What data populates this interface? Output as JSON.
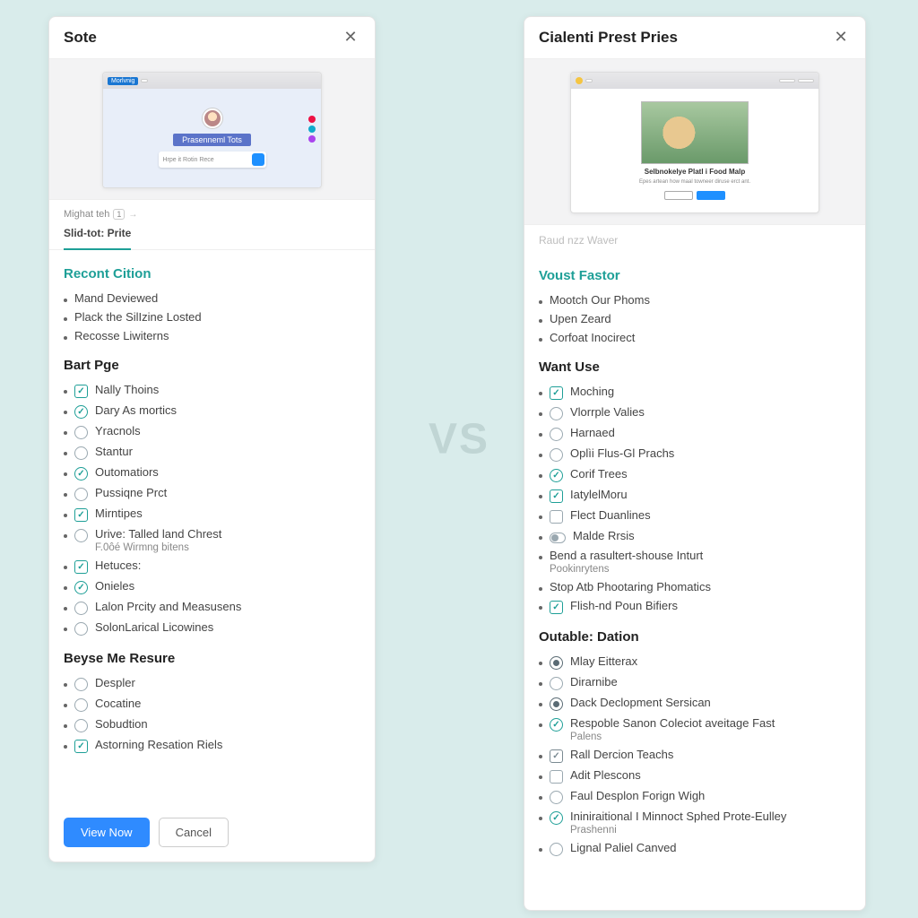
{
  "vs_label": "VS",
  "left": {
    "title": "Sote",
    "preview": {
      "chrome_tag": "Morlvnig",
      "caption": "Prasenneml Tots",
      "search_placeholder": "Hrpe it Rotin Rece"
    },
    "meta_line": "Mighat teh",
    "meta_badge": "1",
    "active_tab": "Slid-tot: Prite",
    "sections": [
      {
        "heading": "Recont Cition",
        "heading_style": "teal",
        "items": [
          {
            "label": "Mand Deviewed",
            "kind": "bullet"
          },
          {
            "label": "Plack the SilIzine Losted",
            "kind": "bullet"
          },
          {
            "label": "Recosse Liwiterns",
            "kind": "bullet"
          }
        ]
      },
      {
        "heading": "Bart Pge",
        "heading_style": "plain",
        "items": [
          {
            "label": "Nally Thoins",
            "kind": "square-filled"
          },
          {
            "label": "Dary As mortics",
            "kind": "circle-filled"
          },
          {
            "label": "Yracnols",
            "kind": "circle-empty"
          },
          {
            "label": "Stantur",
            "kind": "circle-empty"
          },
          {
            "label": "Outomatiors",
            "kind": "circle-filled"
          },
          {
            "label": "Pussiqne Prct",
            "kind": "circle-empty"
          },
          {
            "label": "Mirntipes",
            "kind": "square-filled"
          },
          {
            "label": "Urive: Talled land Chrest",
            "kind": "circle-empty",
            "subtext": "F.0ôé Wirmng bitens"
          },
          {
            "label": "Hetuces:",
            "kind": "square-filled"
          },
          {
            "label": "Onieles",
            "kind": "circle-filled"
          },
          {
            "label": "Lalon Prcity and Measusens",
            "kind": "circle-empty"
          },
          {
            "label": "SolonLarical Licowines",
            "kind": "circle-empty"
          }
        ]
      },
      {
        "heading": "Beyse Me Resure",
        "heading_style": "plain",
        "items": [
          {
            "label": "Despler",
            "kind": "circle-empty"
          },
          {
            "label": "Cocatine",
            "kind": "circle-empty"
          },
          {
            "label": "Sobudtion",
            "kind": "circle-empty"
          },
          {
            "label": "Astorning Resation Riels",
            "kind": "square-filled"
          }
        ]
      }
    ],
    "buttons": {
      "primary": "View Now",
      "secondary": "Cancel"
    }
  },
  "right": {
    "title": "Cialenti Prest Pries",
    "preview": {
      "caption_title": "Selbnokelye Platl i Food Malp",
      "caption_sub": "Epes artean how maal towneer diruse erct ant."
    },
    "watermark": "Raud nzz Waver",
    "sections": [
      {
        "heading": "Voust Fastor",
        "heading_style": "teal",
        "items": [
          {
            "label": "Mootch Our Phoms",
            "kind": "bullet"
          },
          {
            "label": "Upen Zeard",
            "kind": "bullet"
          },
          {
            "label": "Corfoat Inocirect",
            "kind": "bullet"
          }
        ]
      },
      {
        "heading": "Want Use",
        "heading_style": "plain",
        "items": [
          {
            "label": "Moching",
            "kind": "square-filled"
          },
          {
            "label": "Vlorrple Valies",
            "kind": "circle-empty"
          },
          {
            "label": "Harnaed",
            "kind": "circle-empty"
          },
          {
            "label": "Oplìi Flus-Gl Prachs",
            "kind": "circle-empty"
          },
          {
            "label": "Corif Trees",
            "kind": "circle-filled"
          },
          {
            "label": "IatylelMoru",
            "kind": "square-filled"
          },
          {
            "label": "Flect Duanlines",
            "kind": "square-empty"
          },
          {
            "label": "Malde Rrsis",
            "kind": "toggle"
          },
          {
            "label": "Bend a rasultert-shouse Inturt",
            "kind": "bullet",
            "subtext": "Pookinrytens"
          },
          {
            "label": "Stop Atb Phootaring Phomatics",
            "kind": "bullet"
          },
          {
            "label": "Flish-nd Poun Bifiers",
            "kind": "square-filled"
          }
        ]
      },
      {
        "heading": "Outable: Dation",
        "heading_style": "plain",
        "items": [
          {
            "label": "Mlay Eitterax",
            "kind": "radio-dot"
          },
          {
            "label": "Dirarnibe",
            "kind": "circle-empty"
          },
          {
            "label": "Dack Declopment Sersican",
            "kind": "radio-dot"
          },
          {
            "label": "Respoble Sanon Coleciot aveitage Fast",
            "kind": "circle-filled",
            "subtext": "Palens"
          },
          {
            "label": "Rall Dercion Teachs",
            "kind": "square-filled-grey"
          },
          {
            "label": "Adit Plescons",
            "kind": "square-empty"
          },
          {
            "label": "Faul Desplon Forign Wigh",
            "kind": "circle-empty"
          },
          {
            "label": "Ininiraitional I Minnoct Sphed Prote-Eulley",
            "kind": "circle-filled",
            "subtext": "Prashenni"
          },
          {
            "label": "Lignal Paliel Canved",
            "kind": "circle-empty"
          }
        ]
      }
    ]
  }
}
